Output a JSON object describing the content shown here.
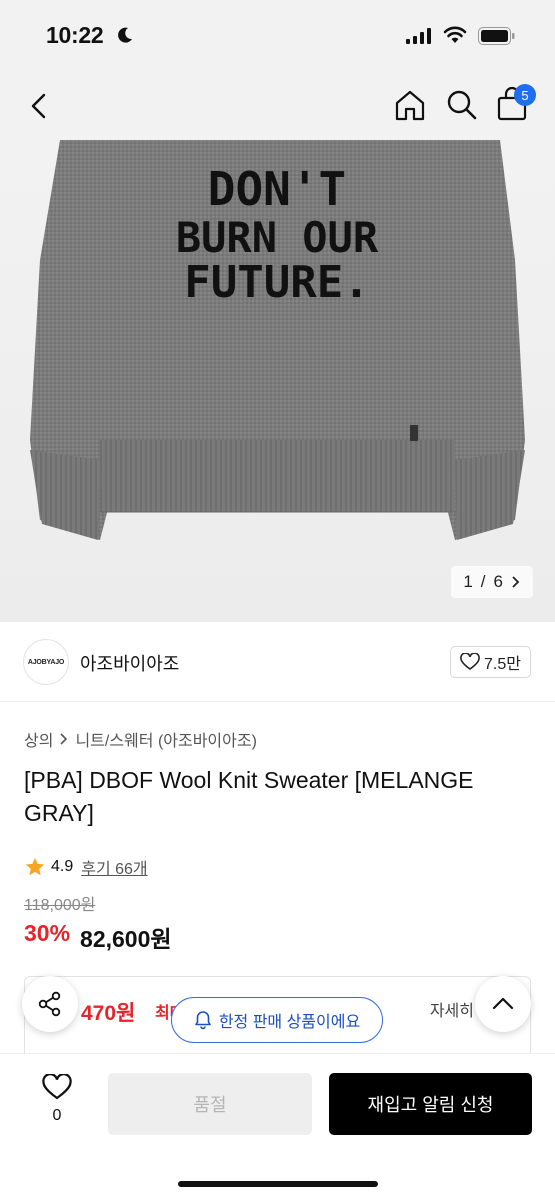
{
  "status_bar": {
    "time": "10:22"
  },
  "nav": {
    "cart_count": "5"
  },
  "product_image": {
    "print_text": "DON'T BURN OUR FUTURE.",
    "counter_current": "1",
    "counter_separator": "/",
    "counter_total": "6",
    "sweater_color": "#7a7a7a"
  },
  "store": {
    "logo_text": "AJOBYAJO",
    "name": "아조바이아조",
    "likes": "7.5만"
  },
  "breadcrumb": {
    "items": [
      "상의",
      "니트/스웨터 (아조바이아조)"
    ]
  },
  "product": {
    "title": "[PBA] DBOF Wool Knit Sweater [MELANGE GRAY]",
    "rating": "4.9",
    "review_label": "후기 66개",
    "original_price": "118,000원",
    "discount": "30%",
    "sale_price": "82,600원"
  },
  "benefit": {
    "amount": "470원",
    "label": "최대",
    "detail": "자세히"
  },
  "limited_notice": "한정 판매 상품이에요",
  "bottom_bar": {
    "wish_count": "0",
    "soldout_label": "품절",
    "restock_label": "재입고 알림 신청"
  },
  "colors": {
    "accent_red": "#e5242b",
    "accent_blue": "#1e6ef0",
    "star": "#f5a623"
  }
}
